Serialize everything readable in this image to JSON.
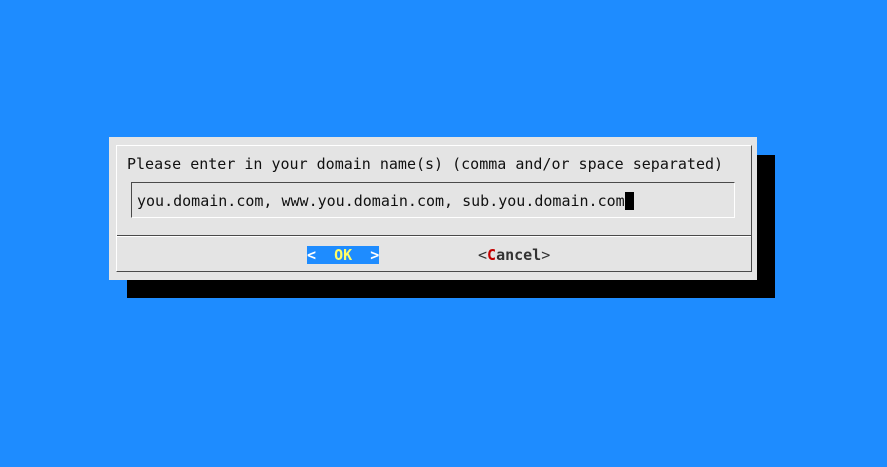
{
  "dialog": {
    "prompt": "Please enter in your domain name(s) (comma and/or space separated)",
    "input_value": "you.domain.com, www.you.domain.com, sub.you.domain.com"
  },
  "buttons": {
    "ok": {
      "open": "<",
      "hotkey": "O",
      "rest": "K",
      "close": ">"
    },
    "cancel": {
      "open": "<",
      "hotkey": "C",
      "rest": "ancel",
      "close": ">"
    }
  },
  "colors": {
    "background": "#1e8cff",
    "dialog": "#e4e4e4",
    "shadow": "#000000",
    "ok_highlight": "#1e8cff",
    "ok_hotkey": "#ffff66",
    "cancel_hotkey": "#c40000"
  }
}
